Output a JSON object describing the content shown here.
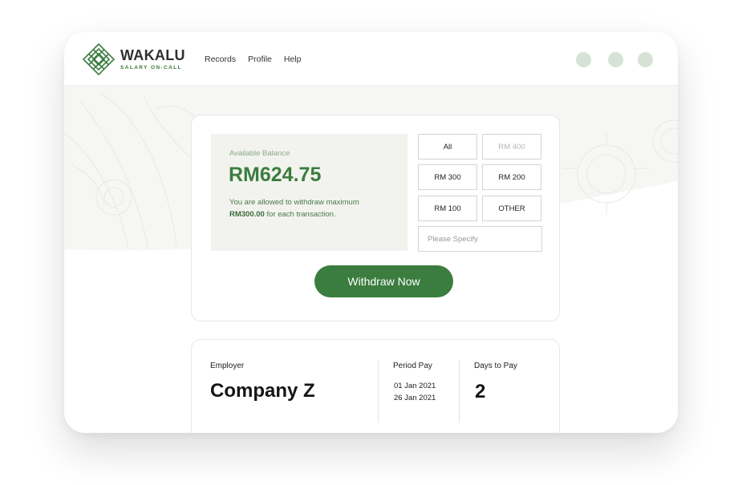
{
  "brand": {
    "name": "WAKALU",
    "tagline": "SALARY ON-CALL"
  },
  "nav": {
    "items": [
      "Records",
      "Profile",
      "Help"
    ]
  },
  "colors": {
    "accent": "#3b7d3e",
    "accent_light": "#d7e2d7",
    "panel_bg": "#f2f3ee"
  },
  "balance": {
    "label": "Available Balance",
    "amount": "RM624.75",
    "note_prefix": "You are allowed to withdraw maximum",
    "note_amount": "RM300.00",
    "note_suffix": "for each transaction."
  },
  "amounts": {
    "all": "All",
    "rm400": "RM 400",
    "rm300": "RM 300",
    "rm200": "RM 200",
    "rm100": "RM 100",
    "other": "OTHER"
  },
  "specify": {
    "placeholder": "Please Specify"
  },
  "withdraw": {
    "label": "Withdraw Now"
  },
  "employer": {
    "label": "Employer",
    "value": "Company Z"
  },
  "period": {
    "label": "Period Pay",
    "start": "01 Jan 2021",
    "end": "26 Jan 2021"
  },
  "days": {
    "label": "Days to Pay",
    "value": "2"
  }
}
